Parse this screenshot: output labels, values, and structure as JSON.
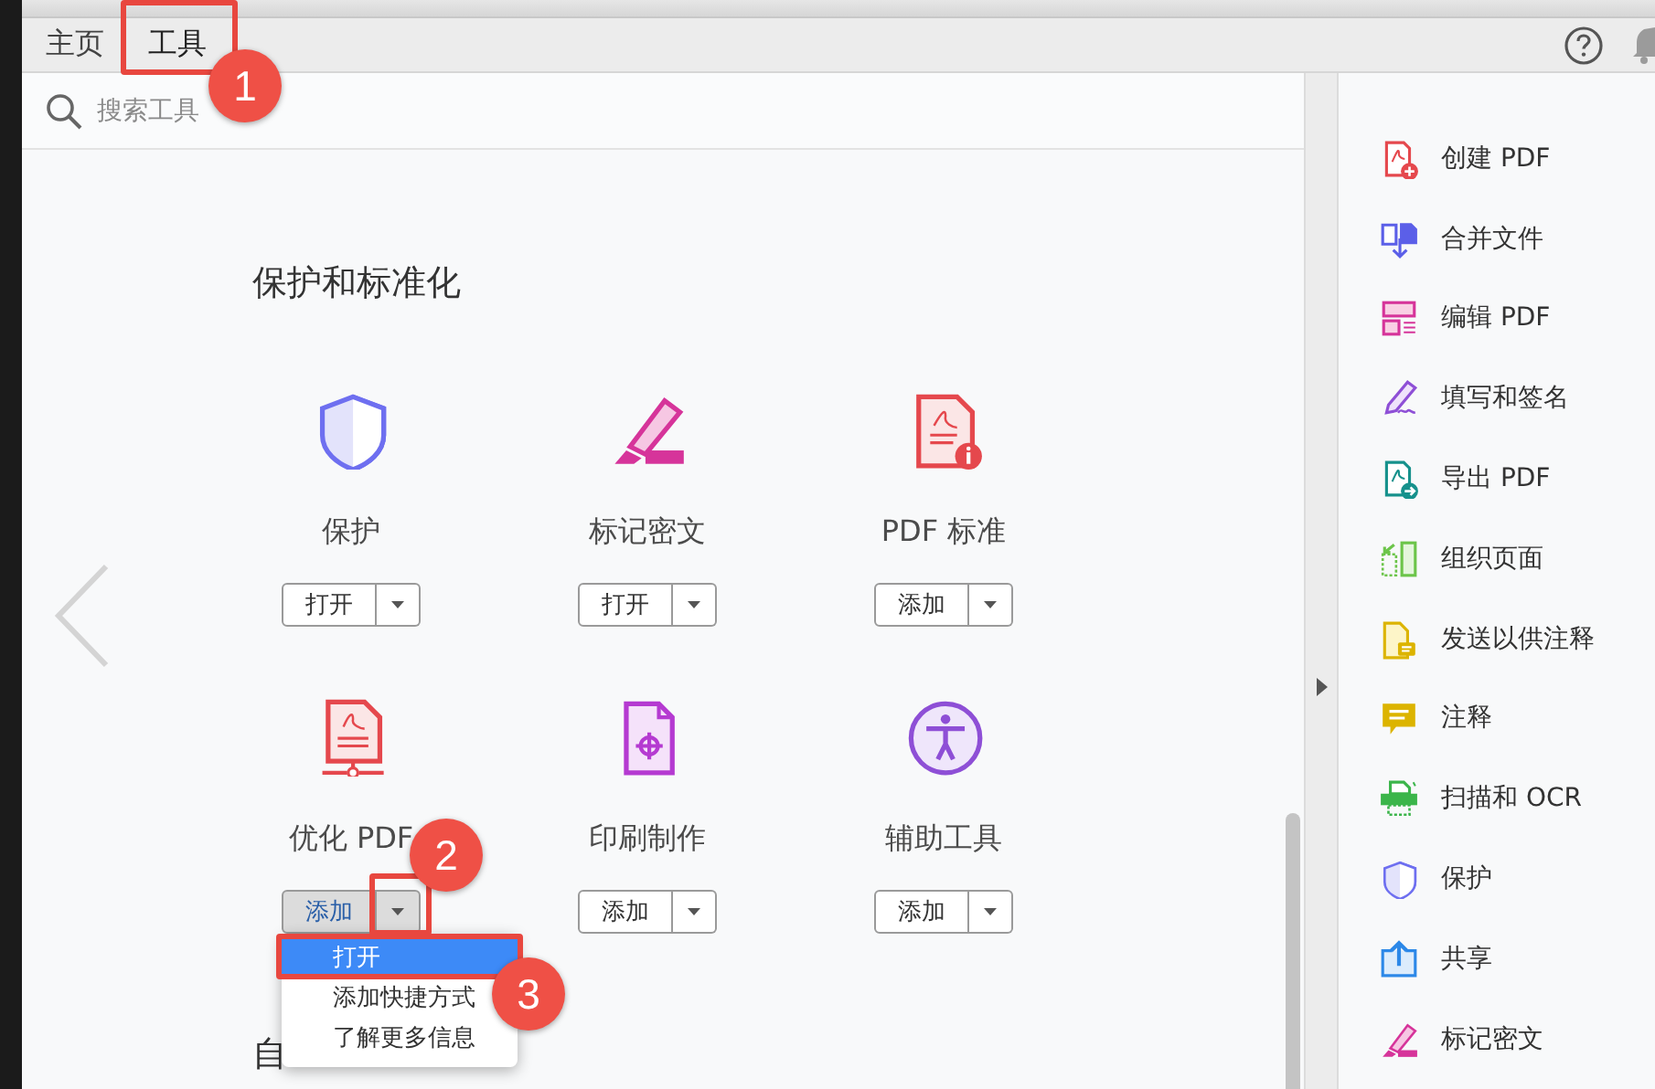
{
  "tabs": [
    {
      "label": "主页",
      "selected": false
    },
    {
      "label": "工具",
      "selected": true
    }
  ],
  "search": {
    "placeholder": "搜索工具"
  },
  "section": {
    "title": "保护和标准化",
    "tools": [
      {
        "name": "保护",
        "kind": "shield",
        "button": "打开",
        "pressed": false
      },
      {
        "name": "标记密文",
        "kind": "redact",
        "button": "打开",
        "pressed": false
      },
      {
        "name": "PDF 标准",
        "kind": "standard",
        "button": "添加",
        "pressed": false
      },
      {
        "name": "优化 PDF",
        "kind": "optimize",
        "button": "添加",
        "pressed": true
      },
      {
        "name": "印刷制作",
        "kind": "print",
        "button": "添加",
        "pressed": false
      },
      {
        "name": "辅助工具",
        "kind": "access",
        "button": "添加",
        "pressed": false
      }
    ]
  },
  "next_section_title": "自",
  "dropdown_menu": {
    "items": [
      {
        "label": "打开",
        "selected": true
      },
      {
        "label": "添加快捷方式",
        "selected": false
      },
      {
        "label": "了解更多信息",
        "selected": false
      }
    ]
  },
  "sidebar": {
    "items": [
      {
        "label": "创建 PDF",
        "kind": "create"
      },
      {
        "label": "合并文件",
        "kind": "combine"
      },
      {
        "label": "编辑 PDF",
        "kind": "edit"
      },
      {
        "label": "填写和签名",
        "kind": "sign"
      },
      {
        "label": "导出 PDF",
        "kind": "export"
      },
      {
        "label": "组织页面",
        "kind": "organize"
      },
      {
        "label": "发送以供注释",
        "kind": "send"
      },
      {
        "label": "注释",
        "kind": "comment"
      },
      {
        "label": "扫描和 OCR",
        "kind": "scan"
      },
      {
        "label": "保护",
        "kind": "shield"
      },
      {
        "label": "共享",
        "kind": "share"
      },
      {
        "label": "标记密文",
        "kind": "redact"
      }
    ]
  },
  "annotations": [
    {
      "label": "1"
    },
    {
      "label": "2"
    },
    {
      "label": "3"
    }
  ]
}
